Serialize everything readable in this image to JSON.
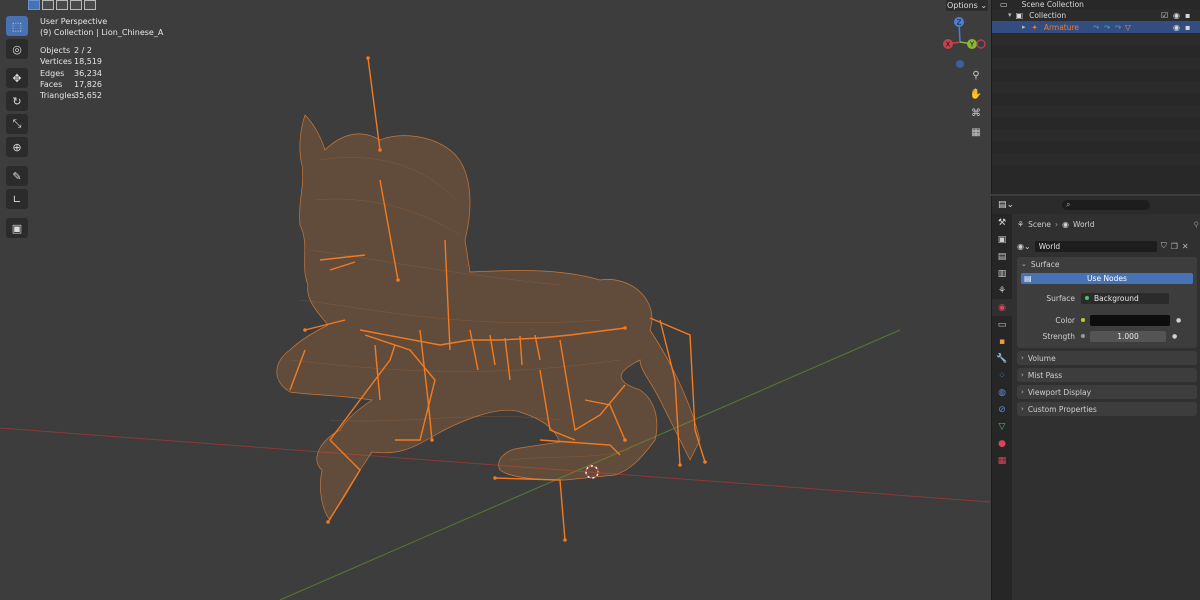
{
  "viewport": {
    "perspective": "User Perspective",
    "collection_line": "(9) Collection | Lion_Chinese_A",
    "options_label": "Options",
    "stats": [
      {
        "label": "Objects",
        "value": "2 / 2"
      },
      {
        "label": "Vertices",
        "value": "18,519"
      },
      {
        "label": "Edges",
        "value": "36,234"
      },
      {
        "label": "Faces",
        "value": "17,826"
      },
      {
        "label": "Triangles",
        "value": "35,652"
      }
    ],
    "gizmo": {
      "z": "Z",
      "y": "Y",
      "x": "X"
    },
    "colors": {
      "armature": "#f47a1f",
      "wire": "#c8793a",
      "x_axis": "#9b3b3b",
      "y_axis": "#5f8a36"
    }
  },
  "outliner": {
    "scene_collection": "Scene Collection",
    "collection": "Collection",
    "armature": "Armature"
  },
  "properties": {
    "search_placeholder": "",
    "breadcrumb_scene": "Scene",
    "breadcrumb_world": "World",
    "world_name": "World",
    "surface_panel": "Surface",
    "use_nodes": "Use Nodes",
    "surface_label": "Surface",
    "surface_value": "Background",
    "color_label": "Color",
    "strength_label": "Strength",
    "strength_value": "1.000",
    "collapsed_panels": [
      "Volume",
      "Mist Pass",
      "Viewport Display",
      "Custom Properties"
    ]
  }
}
